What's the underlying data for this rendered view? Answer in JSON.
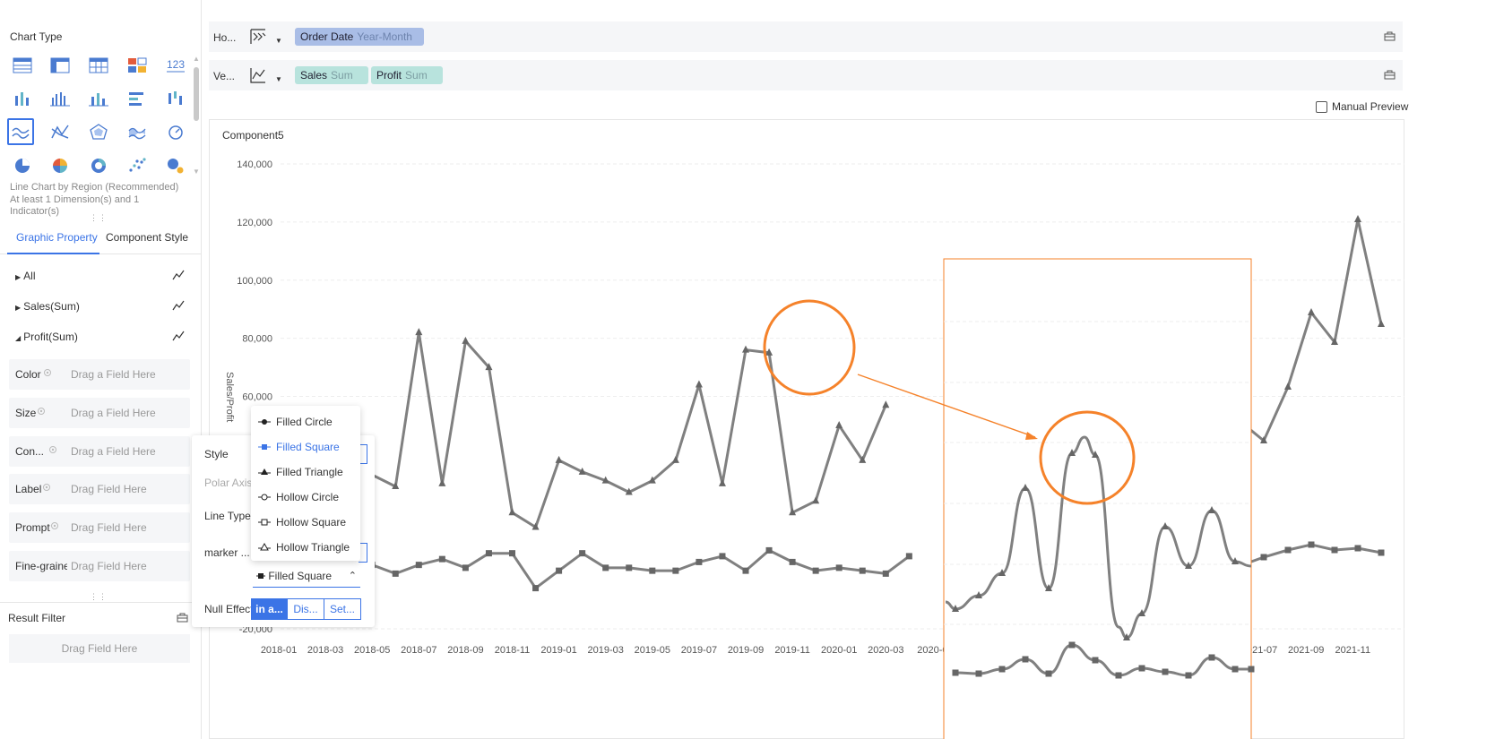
{
  "left_panel": {
    "chart_type_title": "Chart Type",
    "hint": "Line Chart by Region (Recommended) At least 1 Dimension(s) and 1 Indicator(s)",
    "tabs": [
      "Graphic Property",
      "Component Style"
    ],
    "tree": [
      "All",
      "Sales(Sum)",
      "Profit(Sum)"
    ],
    "fields": [
      {
        "name": "Color",
        "drop": "Drag a Field Here"
      },
      {
        "name": "Size",
        "drop": "Drag a Field Here"
      },
      {
        "name": "Con...",
        "drop": "Drag a Field Here"
      },
      {
        "name": "Label",
        "drop": "Drag Field Here"
      },
      {
        "name": "Prompt",
        "drop": "Drag Field Here"
      },
      {
        "name": "Fine-graine",
        "drop": "Drag Field Here"
      }
    ],
    "result_filter": "Result Filter",
    "result_filter_drop": "Drag Field Here"
  },
  "shelves": {
    "horizontal": {
      "label": "Ho...",
      "pills": [
        {
          "name": "Order Date",
          "agg": "Year-Month"
        }
      ]
    },
    "vertical": {
      "label": "Ve...",
      "pills": [
        {
          "name": "Sales",
          "agg": "Sum"
        },
        {
          "name": "Profit",
          "agg": "Sum"
        }
      ]
    }
  },
  "manual_preview": "Manual Preview",
  "component_title": "Component5",
  "style_panel": {
    "style": "Style",
    "polar_axis": "Polar Axis",
    "line_type": "Line Type",
    "marker": "marker ...",
    "marker_selected": "Filled Square",
    "null_effect": "Null Effect",
    "null_options": [
      "in a...",
      "Dis...",
      "Set..."
    ]
  },
  "marker_menu": [
    "Filled Circle",
    "Filled Square",
    "Filled Triangle",
    "Hollow Circle",
    "Hollow Square",
    "Hollow Triangle"
  ],
  "colors": {
    "accent": "#3b74e6",
    "line": "#808080",
    "annotation": "#f5822a"
  },
  "chart_data": {
    "type": "line",
    "title": "Component5",
    "ylabel": "Sales/Profit",
    "ylim": [
      -20000,
      140000
    ],
    "yticks": [
      "140,000",
      "120,000",
      "100,000",
      "80,000",
      "60,000",
      "-20,000"
    ],
    "x": [
      "2018-01",
      "2018-02",
      "2018-03",
      "2018-04",
      "2018-05",
      "2018-06",
      "2018-07",
      "2018-08",
      "2018-09",
      "2018-10",
      "2018-11",
      "2018-12",
      "2019-01",
      "2019-02",
      "2019-03",
      "2019-04",
      "2019-05",
      "2019-06",
      "2019-07",
      "2019-08",
      "2019-09",
      "2019-10",
      "2019-11",
      "2019-12",
      "2020-01",
      "2020-02",
      "2020-03",
      "2020-04",
      "2020-05",
      "2020-06",
      "2020-07",
      "2020-08",
      "2020-09",
      "2020-10",
      "2020-11",
      "2020-12",
      "2021-01",
      "2021-02",
      "2021-03",
      "2021-04",
      "2021-05",
      "2021-06",
      "2021-07",
      "2021-08",
      "2021-09",
      "2021-10",
      "2021-11",
      "2021-12"
    ],
    "xticks": [
      "2018-01",
      "2018-03",
      "2018-05",
      "2018-07",
      "2018-09",
      "2018-11",
      "2019-01",
      "2019-03",
      "2019-05",
      "2019-07",
      "2019-09",
      "2019-11",
      "2020-01",
      "2020-03",
      "2020-0",
      "2021-07",
      "2021-09",
      "2021-11"
    ],
    "series": [
      {
        "name": "Sales",
        "values": [
          36000,
          28000,
          24000,
          34000,
          33000,
          29000,
          82000,
          30000,
          79000,
          70000,
          20000,
          15000,
          38000,
          34000,
          31000,
          27000,
          31000,
          38000,
          64000,
          30000,
          76000,
          75000,
          20000,
          24000,
          50000,
          38000,
          57000,
          null,
          null,
          null,
          null,
          null,
          null,
          null,
          null,
          null,
          null,
          null,
          null,
          null,
          null,
          null,
          null,
          null,
          null,
          null,
          null,
          null
        ]
      },
      {
        "name": "Profit",
        "values": [
          0,
          1000,
          2000,
          1000,
          2000,
          -1000,
          2000,
          4000,
          1000,
          6000,
          6000,
          -6000,
          0,
          6000,
          1000,
          1000,
          0,
          0,
          3000,
          5000,
          0,
          7000,
          3000,
          0,
          1000,
          0,
          -1000,
          5000,
          null,
          null,
          null,
          null,
          null,
          null,
          null,
          null,
          null,
          null,
          null,
          null,
          null,
          null,
          null,
          null,
          null,
          null,
          null,
          null
        ]
      },
      {
        "name": "Sales",
        "values": [
          null,
          null,
          null,
          null,
          null,
          null,
          null,
          null,
          null,
          null,
          null,
          null,
          null,
          null,
          null,
          null,
          null,
          null,
          null,
          null,
          null,
          null,
          null,
          null,
          null,
          null,
          null,
          null,
          null,
          null,
          null,
          null,
          null,
          null,
          null,
          null,
          null,
          null,
          null,
          null,
          null,
          null,
          null,
          null,
          null,
          null,
          null,
          null
        ]
      }
    ]
  }
}
